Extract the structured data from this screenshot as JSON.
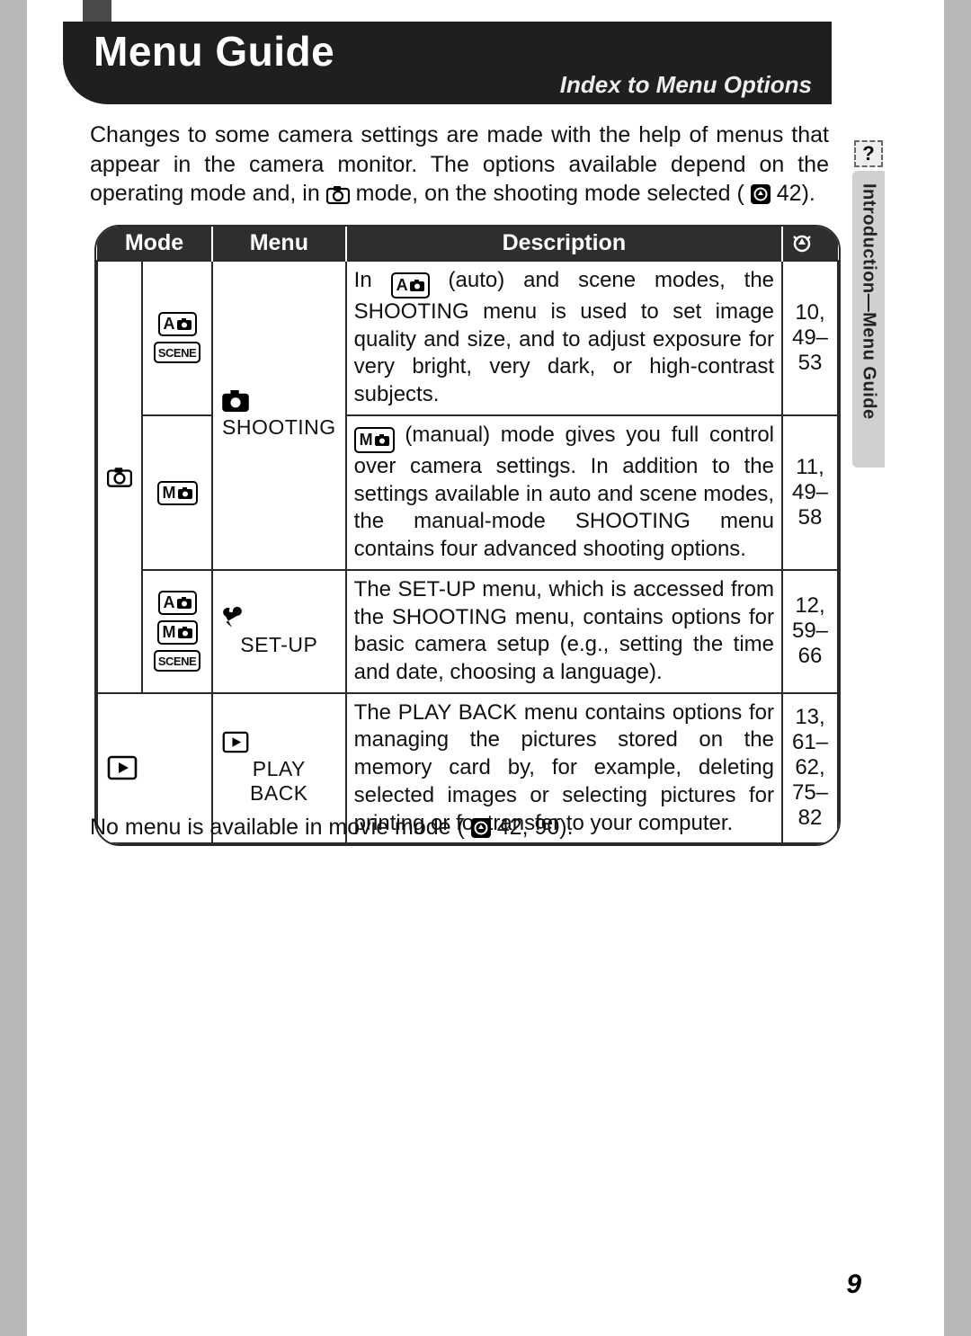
{
  "header": {
    "title": "Menu Guide",
    "subtitle": "Index to Menu Options"
  },
  "side_tab": "Introduction—Menu Guide",
  "intro": {
    "line1": "Changes to some camera settings are made with the help of menus that appear in the camera monitor.  The options available depend on the operating mode and, in ",
    "line2": " mode, on the shooting mode selected (",
    "ref": " 42)."
  },
  "table": {
    "headers": {
      "mode": "Mode",
      "menu": "Menu",
      "description": "Description",
      "pages": ""
    },
    "rows": [
      {
        "menu_label": "SHOOTING",
        "desc_prefix": "In ",
        "desc_rest": " (auto) and scene modes, the SHOOTING menu is used to set image quality and size, and to adjust exposure for very bright, very dark, or high-contrast subjects.",
        "pages": "10,\n49–\n53"
      },
      {
        "desc_prefix": "",
        "desc_mid": " (manual) mode gives you full control over camera settings.  In addition to the settings available in auto and scene modes, the manual-mode SHOOTING menu contains four advanced shooting options.",
        "pages": "11,\n49–\n58"
      },
      {
        "menu_label": "SET-UP",
        "desc": "The SET-UP menu, which is accessed from the SHOOTING menu, contains options for basic camera setup (e.g., setting the time and date, choosing a language).",
        "pages": "12,\n59–\n66"
      },
      {
        "menu_label": "PLAY\nBACK",
        "desc": "The PLAY BACK menu contains options for managing the pictures stored on the memory card by, for example, deleting selected images or selecting pictures for printing or for transfer to your computer.",
        "pages": "13,\n61–\n62,\n75–\n82"
      }
    ]
  },
  "note": {
    "text": "No menu is available in movie mode (",
    "refs": " 42, 90)."
  },
  "page_number": "9"
}
